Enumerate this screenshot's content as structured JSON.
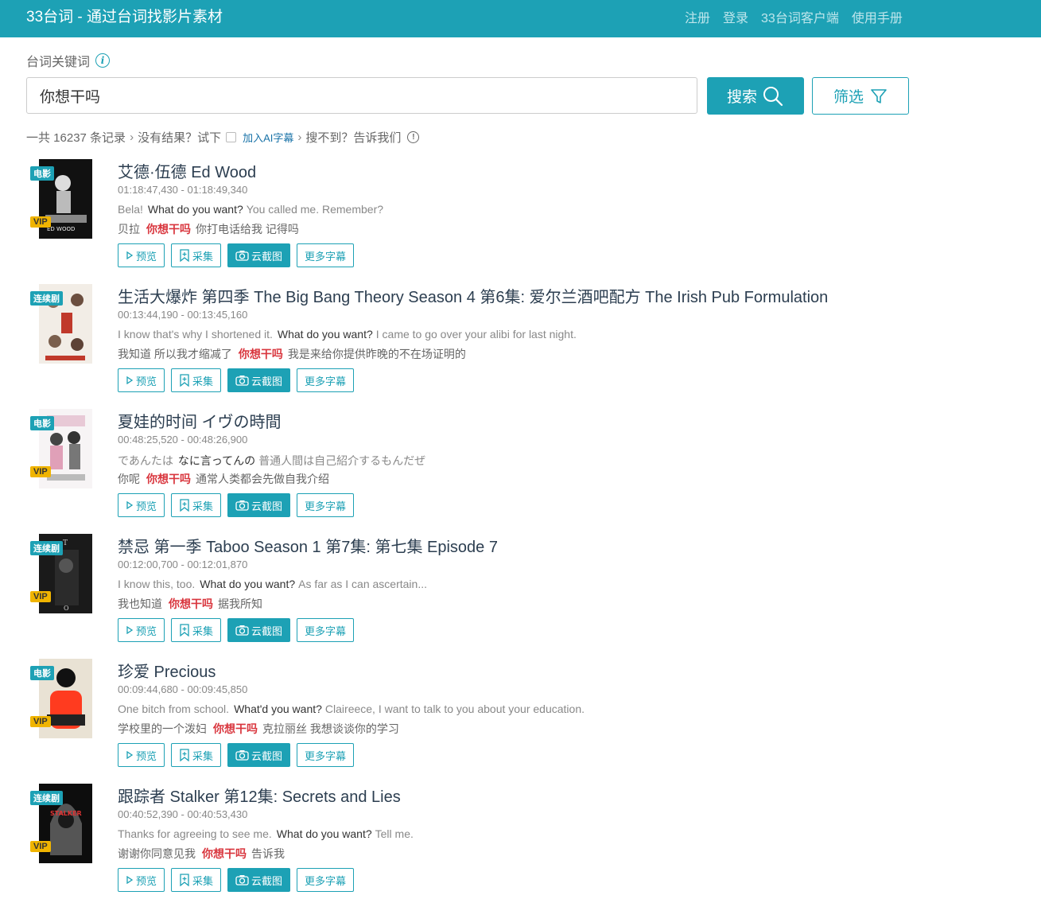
{
  "header": {
    "brand": "33台词 - 通过台词找影片素材",
    "nav": [
      "注册",
      "登录",
      "33台词客户端",
      "使用手册"
    ]
  },
  "search": {
    "label": "台词关键词",
    "value": "你想干吗",
    "search_button": "搜索",
    "filter_button": "筛选"
  },
  "summary": {
    "count_text": "一共 16237 条记录",
    "no_result": "没有结果？试下",
    "ai_link": "加入AI字幕",
    "not_found": "搜不到？告诉我们"
  },
  "actions": {
    "preview": "预览",
    "collect": "采集",
    "screenshot": "云截图",
    "more": "更多字幕"
  },
  "results": [
    {
      "type_tag": "电影",
      "vip": "VIP",
      "title": "艾德·伍德 Ed Wood",
      "time": "01:18:47,430 - 01:18:49,340",
      "en_before": "Bela!",
      "en_hit": "What do you want?",
      "en_after": "You called me. Remember?",
      "zh_before": "贝拉",
      "zh_hit": "你想干吗",
      "zh_after": "你打电话给我 记得吗"
    },
    {
      "type_tag": "连续剧",
      "vip": "",
      "title": "生活大爆炸 第四季 The Big Bang Theory Season 4 第6集: 爱尔兰酒吧配方 The Irish Pub Formulation",
      "time": "00:13:44,190 - 00:13:45,160",
      "en_before": "I know that's why I shortened it.",
      "en_hit": "What do you want?",
      "en_after": "I came to go over your alibi for last night.",
      "zh_before": "我知道 所以我才缩减了",
      "zh_hit": "你想干吗",
      "zh_after": "我是来给你提供昨晚的不在场证明的"
    },
    {
      "type_tag": "电影",
      "vip": "VIP",
      "title": "夏娃的时间 イヴの時間",
      "time": "00:48:25,520 - 00:48:26,900",
      "en_before": "であんたは",
      "en_hit": "なに言ってんの",
      "en_after": "普通人間は自己紹介するもんだぜ",
      "zh_before": "你呢",
      "zh_hit": "你想干吗",
      "zh_after": "通常人类都会先做自我介绍"
    },
    {
      "type_tag": "连续剧",
      "vip": "VIP",
      "title": "禁忌 第一季 Taboo Season 1 第7集: 第七集 Episode 7",
      "time": "00:12:00,700 - 00:12:01,870",
      "en_before": "I know this, too.",
      "en_hit": "What do you want?",
      "en_after": "As far as I can ascertain...",
      "zh_before": "我也知道",
      "zh_hit": "你想干吗",
      "zh_after": "据我所知"
    },
    {
      "type_tag": "电影",
      "vip": "VIP",
      "title": "珍爱 Precious",
      "time": "00:09:44,680 - 00:09:45,850",
      "en_before": "One bitch from school.",
      "en_hit": "What'd you want?",
      "en_after": "Claireece, I want to talk to you about your education.",
      "zh_before": "学校里的一个泼妇",
      "zh_hit": "你想干吗",
      "zh_after": "克拉丽丝 我想谈谈你的学习"
    },
    {
      "type_tag": "连续剧",
      "vip": "VIP",
      "title": "跟踪者 Stalker 第12集: Secrets and Lies",
      "time": "00:40:52,390 - 00:40:53,430",
      "en_before": "Thanks for agreeing to see me.",
      "en_hit": "What do you want?",
      "en_after": "Tell me.",
      "zh_before": "谢谢你同意见我",
      "zh_hit": "你想干吗",
      "zh_after": "告诉我"
    }
  ],
  "colors": {
    "accent": "#1da1b5",
    "hit_red": "#d9363e",
    "vip": "#f0b400"
  }
}
